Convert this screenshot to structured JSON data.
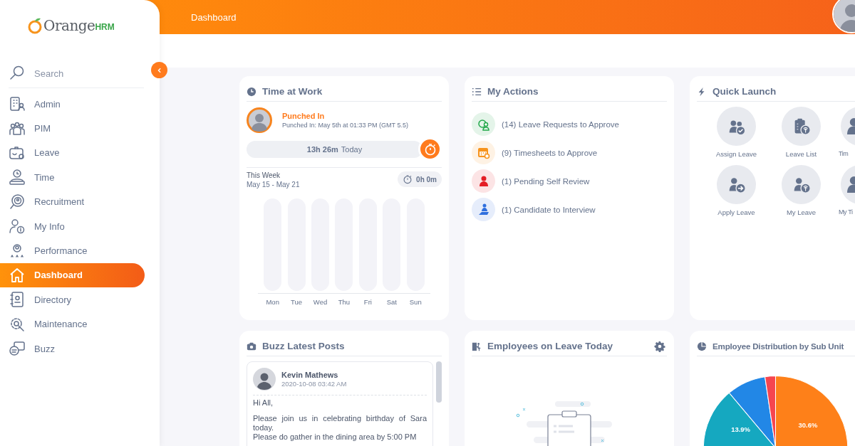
{
  "brand": {
    "name": "Orange",
    "suffix": "HRM"
  },
  "topbar": {
    "title": "Dashboard"
  },
  "sidebar": {
    "search": {
      "placeholder": "Search"
    },
    "items": [
      {
        "label": "Admin",
        "selected": false
      },
      {
        "label": "PIM",
        "selected": false
      },
      {
        "label": "Leave",
        "selected": false
      },
      {
        "label": "Time",
        "selected": false
      },
      {
        "label": "Recruitment",
        "selected": false
      },
      {
        "label": "My Info",
        "selected": false
      },
      {
        "label": "Performance",
        "selected": false
      },
      {
        "label": "Dashboard",
        "selected": true
      },
      {
        "label": "Directory",
        "selected": false
      },
      {
        "label": "Maintenance",
        "selected": false
      },
      {
        "label": "Buzz",
        "selected": false
      }
    ]
  },
  "time_at_work": {
    "title": "Time at Work",
    "status": "Punched In",
    "detail": "Punched In: May 5th at 01:33 PM (GMT 5.5)",
    "today": "**13h 26m** Today",
    "week_label": "This Week",
    "week_range": "May 15 - May 21",
    "week_total": "0h 0m",
    "days": [
      "Mon",
      "Tue",
      "Wed",
      "Thu",
      "Fri",
      "Sat",
      "Sun"
    ]
  },
  "my_actions": {
    "title": "My Actions",
    "items": [
      {
        "label": "(14) Leave Requests to Approve",
        "color": "#22a84a"
      },
      {
        "label": "(9) Timesheets to Approve",
        "color": "#f7941d"
      },
      {
        "label": "(1) Pending Self Review",
        "color": "#e41e26"
      },
      {
        "label": "(1) Candidate to Interview",
        "color": "#2f6fde"
      }
    ]
  },
  "quick_launch": {
    "title": "Quick Launch",
    "items": [
      {
        "label": "Assign Leave"
      },
      {
        "label": "Leave List"
      },
      {
        "label": "Tim"
      },
      {
        "label": "Apply Leave"
      },
      {
        "label": "My Leave"
      },
      {
        "label": "My Ti"
      }
    ]
  },
  "buzz": {
    "title": "Buzz Latest Posts",
    "post": {
      "author": "Kevin Mathews",
      "time": "2020-10-08 03:42 AM",
      "paragraphs": [
        "Hi All,",
        "Please join us in celebrating birthday of Sara today.",
        "Please do gather in the dining area by 5:00 PM"
      ]
    }
  },
  "employees_on_leave": {
    "title": "Employees on Leave Today"
  },
  "distribution": {
    "title": "Employee Distribution by Sub Unit",
    "slices": [
      {
        "color": "#fe8019"
      },
      {
        "color": "#15a8c0"
      },
      {
        "color": "#2287e6"
      },
      {
        "color": "#f6454f"
      }
    ],
    "labels": [
      "13.9%",
      "30.6%"
    ]
  }
}
